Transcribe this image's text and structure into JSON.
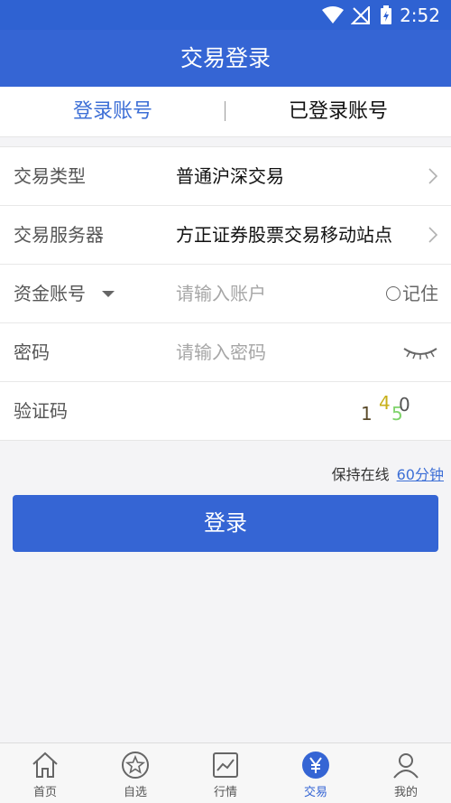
{
  "status_bar": {
    "time": "2:52"
  },
  "header": {
    "title": "交易登录"
  },
  "tabs": [
    {
      "label": "登录账号"
    },
    {
      "label": "已登录账号"
    }
  ],
  "form": {
    "trade_type": {
      "label": "交易类型",
      "value": "普通沪深交易"
    },
    "server": {
      "label": "交易服务器",
      "value": "方正证券股票交易移动站点"
    },
    "account": {
      "label": "资金账号",
      "placeholder": "请输入账户",
      "remember_label": "记住"
    },
    "password": {
      "label": "密码",
      "placeholder": "请输入密码"
    },
    "captcha": {
      "label": "验证码",
      "digits": [
        "1",
        "4",
        "5",
        "0"
      ]
    }
  },
  "keep_online": {
    "label": "保持在线",
    "value": "60分钟"
  },
  "login_button": {
    "label": "登录"
  },
  "bottom_nav": [
    {
      "label": "首页",
      "icon": "home-icon"
    },
    {
      "label": "自选",
      "icon": "star-icon"
    },
    {
      "label": "行情",
      "icon": "chart-icon"
    },
    {
      "label": "交易",
      "icon": "yuan-icon"
    },
    {
      "label": "我的",
      "icon": "person-icon"
    }
  ],
  "colors": {
    "primary": "#3565d4",
    "link": "#3d6fd6"
  }
}
